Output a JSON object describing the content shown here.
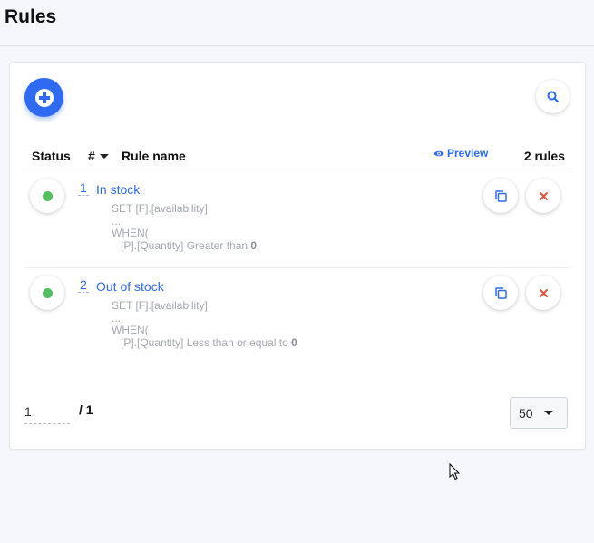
{
  "header": {
    "title": "Rules"
  },
  "toolbar": {
    "add_icon": "plus-icon",
    "search_icon": "search-icon"
  },
  "table": {
    "columns": {
      "status": "Status",
      "number": "#",
      "name": "Rule name",
      "preview": "Preview",
      "count": "2 rules"
    },
    "rows": [
      {
        "number": "1",
        "name": "In stock",
        "status_color": "#52c05f",
        "set_line": "SET [F].[availability]",
        "ellipsis": "...",
        "when": "WHEN(",
        "condition_field": "[P].[Quantity]",
        "condition_op": " Greater than ",
        "condition_value": "0"
      },
      {
        "number": "2",
        "name": "Out of stock",
        "status_color": "#52c05f",
        "set_line": "SET [F].[availability]",
        "ellipsis": "...",
        "when": "WHEN(",
        "condition_field": "[P].[Quantity]",
        "condition_op": " Less than or equal to ",
        "condition_value": "0"
      }
    ]
  },
  "pagination": {
    "current_page": "1",
    "total": "/ 1",
    "per_page": "50"
  },
  "colors": {
    "accent": "#2f6bf2",
    "success": "#52c05f",
    "danger": "#e0533d"
  }
}
